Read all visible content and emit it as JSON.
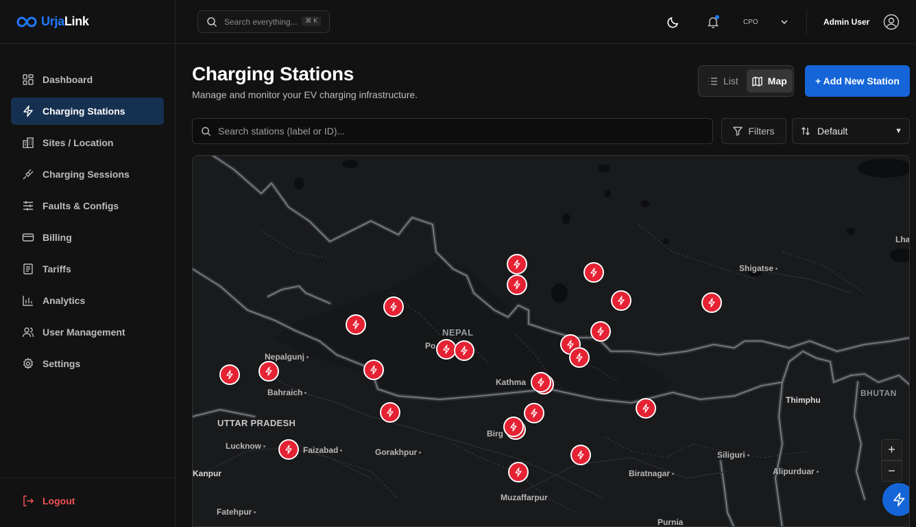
{
  "brand": {
    "part1": "Urja",
    "part2": "Link"
  },
  "header": {
    "search_placeholder": "Search everything...",
    "shortcut": "⌘ K",
    "role": "CPO",
    "user_name": "Admin User"
  },
  "sidebar": {
    "items": [
      {
        "label": "Dashboard",
        "icon": "grid-icon"
      },
      {
        "label": "Charging Stations",
        "icon": "zap-icon",
        "active": true
      },
      {
        "label": "Sites / Location",
        "icon": "building-icon"
      },
      {
        "label": "Charging Sessions",
        "icon": "plug-icon"
      },
      {
        "label": "Faults & Configs",
        "icon": "sliders-icon"
      },
      {
        "label": "Billing",
        "icon": "credit-card-icon"
      },
      {
        "label": "Tariffs",
        "icon": "receipt-icon"
      },
      {
        "label": "Analytics",
        "icon": "bar-chart-icon"
      },
      {
        "label": "User Management",
        "icon": "users-icon"
      },
      {
        "label": "Settings",
        "icon": "gear-icon"
      }
    ],
    "logout_label": "Logout"
  },
  "page": {
    "title": "Charging Stations",
    "subtitle": "Manage and monitor your EV charging infrastructure.",
    "view_list": "List",
    "view_map": "Map",
    "add_button": "+ Add New Station",
    "search_placeholder": "Search stations (label or ID)...",
    "filters_label": "Filters",
    "sort_value": "Default"
  },
  "map": {
    "labels": {
      "lhasa": "Lha",
      "shigatse": "Shigatse",
      "nepal": "NEPAL",
      "pokhara": "Po",
      "nepalgunj": "Nepalgunj",
      "bahraich": "Bahraich",
      "kathmandu": "Kathma",
      "uttar_pradesh": "UTTAR PRADESH",
      "lucknow": "Lucknow",
      "faizabad": "Faizabad",
      "gorakhpur": "Gorakhpur",
      "birgunj": "Birg",
      "thimphu": "Thimphu",
      "bhutan": "BHUTAN",
      "siliguri": "Siliguri",
      "biratnagar": "Biratnagar",
      "alipurduar": "Alipurduar",
      "kanpur": "Kanpur",
      "muzaffarpur": "Muzaffarpur",
      "fatehpur": "Fatehpur",
      "purnia": "Purnia"
    },
    "zoom_in": "+",
    "zoom_out": "−",
    "station_count_markers": 27,
    "marker_color": "#e52233",
    "accent": "#1565d8"
  }
}
